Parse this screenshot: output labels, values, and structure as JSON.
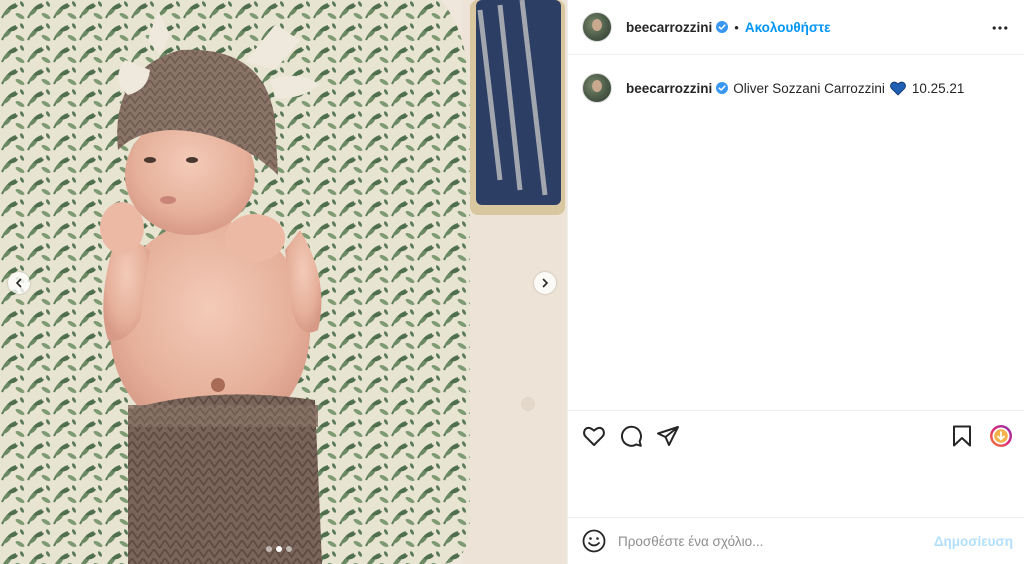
{
  "post": {
    "author": "beecarrozzini",
    "follow_separator": "•",
    "follow_label": "Ακολουθήστε",
    "caption_username": "beecarrozzini",
    "caption_text": "Oliver Sozzani Carrozzini",
    "caption_emoji": "blue-heart",
    "caption_date": "10.25.21",
    "comment_placeholder": "Προσθέστε ένα σχόλιο...",
    "post_label": "Δημοσίευση"
  },
  "carousel": {
    "total": 3,
    "active_index": 1
  },
  "colors": {
    "accent": "#0095f6",
    "accent_disabled": "#b2dffc",
    "verified": "#3897f0",
    "heart": "#1f5fb4"
  },
  "icons": [
    "chevron-left-icon",
    "chevron-right-icon",
    "verified-badge-icon",
    "more-options-icon",
    "like-icon",
    "comment-icon",
    "share-icon",
    "save-icon",
    "collection-icon",
    "emoji-icon"
  ]
}
